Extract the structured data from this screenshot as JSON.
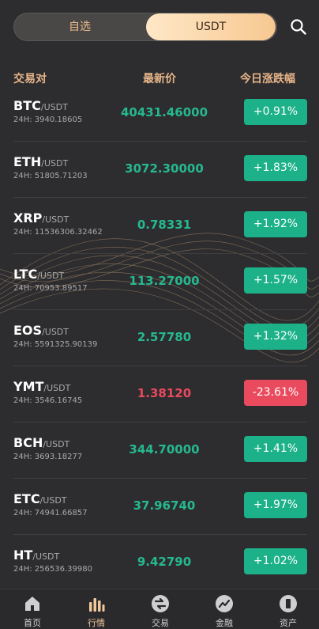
{
  "tabs": {
    "left": "自选",
    "right": "USDT"
  },
  "header": {
    "pair": "交易对",
    "price": "最新价",
    "change": "今日涨跌幅"
  },
  "rows": [
    {
      "base": "BTC",
      "quote": "/USDT",
      "vol": "24H: 3940.18605",
      "price": "40431.46000",
      "change": "+0.91%",
      "dir": "up"
    },
    {
      "base": "ETH",
      "quote": "/USDT",
      "vol": "24H: 51805.71203",
      "price": "3072.30000",
      "change": "+1.83%",
      "dir": "up"
    },
    {
      "base": "XRP",
      "quote": "/USDT",
      "vol": "24H: 11536306.32462",
      "price": "0.78331",
      "change": "+1.92%",
      "dir": "up"
    },
    {
      "base": "LTC",
      "quote": "/USDT",
      "vol": "24H: 70953.89517",
      "price": "113.27000",
      "change": "+1.57%",
      "dir": "up"
    },
    {
      "base": "EOS",
      "quote": "/USDT",
      "vol": "24H: 5591325.90139",
      "price": "2.57780",
      "change": "+1.32%",
      "dir": "up"
    },
    {
      "base": "YMT",
      "quote": "/USDT",
      "vol": "24H: 3546.16745",
      "price": "1.38120",
      "change": "-23.61%",
      "dir": "down"
    },
    {
      "base": "BCH",
      "quote": "/USDT",
      "vol": "24H: 3693.18277",
      "price": "344.70000",
      "change": "+1.41%",
      "dir": "up"
    },
    {
      "base": "ETC",
      "quote": "/USDT",
      "vol": "24H: 74941.66857",
      "price": "37.96740",
      "change": "+1.97%",
      "dir": "up"
    },
    {
      "base": "HT",
      "quote": "/USDT",
      "vol": "24H: 256536.39980",
      "price": "9.42790",
      "change": "+1.02%",
      "dir": "up"
    }
  ],
  "nav": [
    {
      "label": "首页",
      "icon": "home-icon"
    },
    {
      "label": "行情",
      "icon": "market-icon"
    },
    {
      "label": "交易",
      "icon": "trade-icon"
    },
    {
      "label": "金融",
      "icon": "finance-icon"
    },
    {
      "label": "资产",
      "icon": "assets-icon"
    }
  ],
  "colors": {
    "up": "#1cb189",
    "down": "#ea4a5e",
    "accent": "#e8b58a"
  }
}
